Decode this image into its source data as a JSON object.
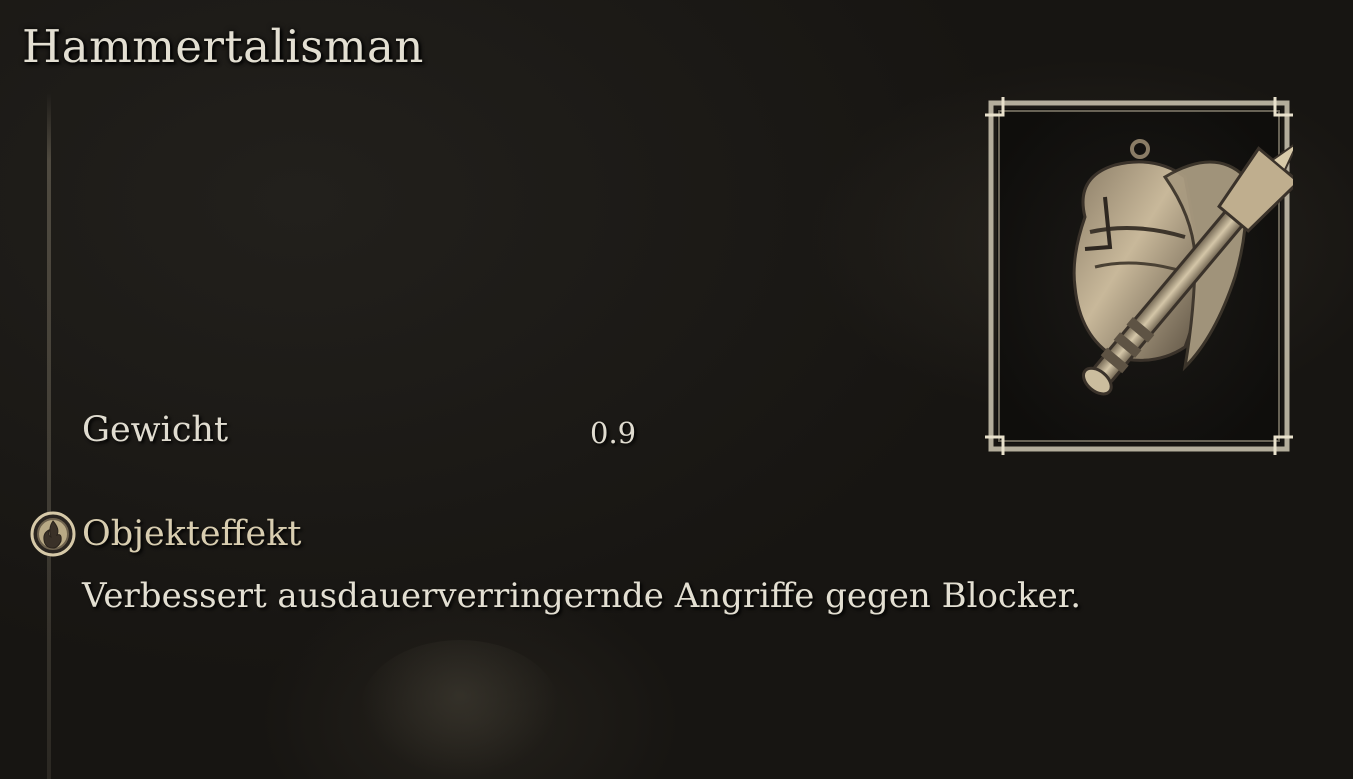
{
  "item": {
    "name": "Hammertalisman",
    "icon": "hammer-talisman-icon"
  },
  "stats": [
    {
      "label": "Gewicht",
      "value": "0.9"
    }
  ],
  "effect": {
    "icon": "flame-medallion-icon",
    "heading": "Objekteffekt",
    "description": "Verbessert ausdauerverringernde Angriffe gegen Blocker."
  },
  "colors": {
    "background": "#1a1815",
    "text": "#e3dfd2",
    "heading_accent": "#d8cdb0",
    "frame": "#cfc8b4"
  }
}
